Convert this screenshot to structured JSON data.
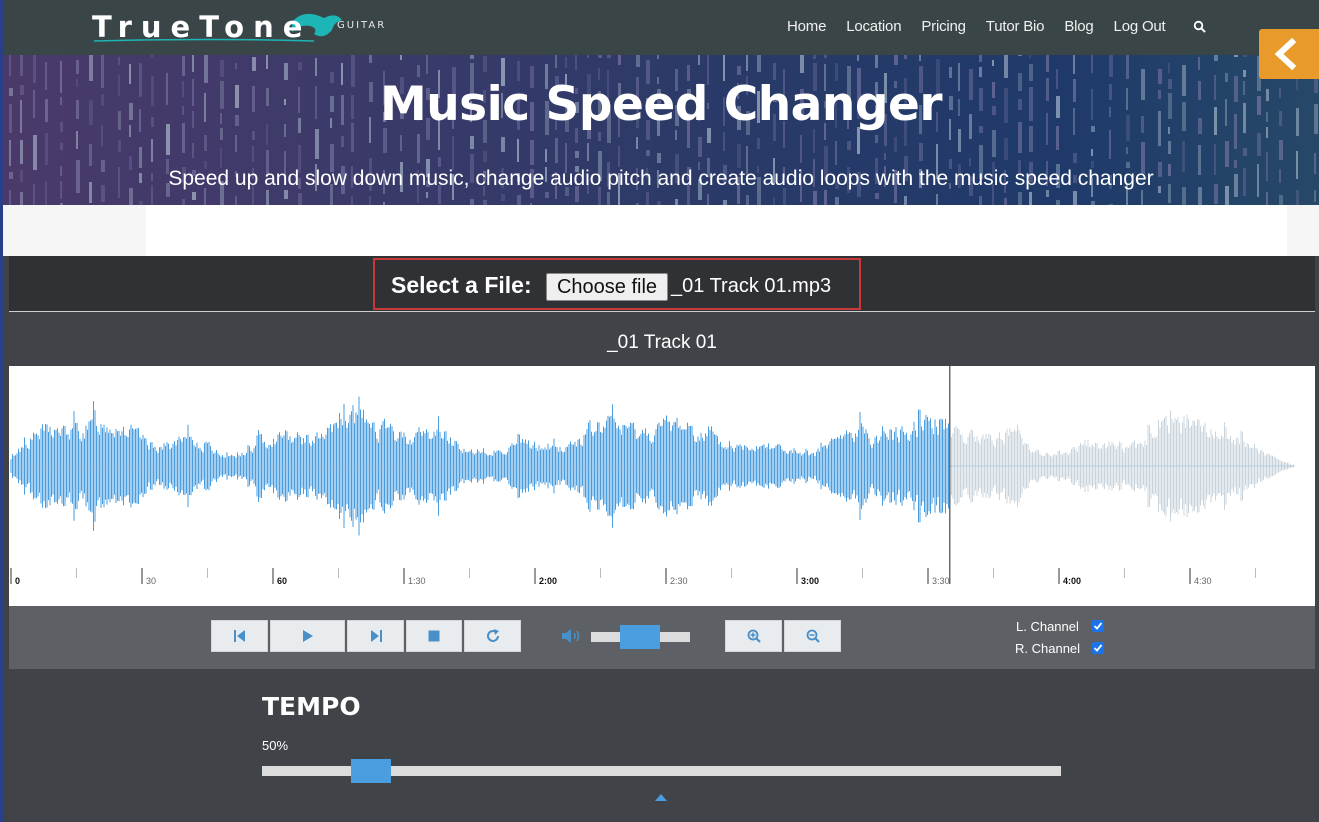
{
  "brand": {
    "logo_text": "TrueTone",
    "logo_sub": "GUITAR"
  },
  "nav": {
    "items": [
      "Home",
      "Location",
      "Pricing",
      "Tutor Bio",
      "Blog",
      "Log Out"
    ],
    "search_icon": "search-icon",
    "back_icon": "chevron-left-icon"
  },
  "hero": {
    "title": "Music Speed Changer",
    "subtitle": "Speed up and slow down music, change audio pitch and create audio loops with the music speed changer"
  },
  "file": {
    "label": "Select a File:",
    "button_label": "Choose file",
    "file_name": "_01 Track 01.mp3"
  },
  "player": {
    "track_title": "_01 Track 01",
    "timeline_labels": [
      "0",
      "30",
      "60",
      "1:30",
      "2:00",
      "2:30",
      "3:00",
      "3:30",
      "4:00",
      "4:30"
    ],
    "playhead_time": "3:35",
    "played_color": "#4a9ee0",
    "unplayed_color": "#c9d4dc",
    "buttons": [
      "skip-back-icon",
      "play-icon",
      "skip-forward-icon",
      "stop-icon",
      "loop-icon"
    ],
    "volume_icon": "volume-icon",
    "volume_level": 0.4,
    "zoom_buttons": [
      "zoom-in-icon",
      "zoom-out-icon"
    ],
    "channels": [
      {
        "label": "L. Channel",
        "checked": true
      },
      {
        "label": "R. Channel",
        "checked": true
      }
    ]
  },
  "tempo": {
    "title": "TEMPO",
    "value": "50%",
    "level": 0.11,
    "accent": "#4a9ee0"
  }
}
